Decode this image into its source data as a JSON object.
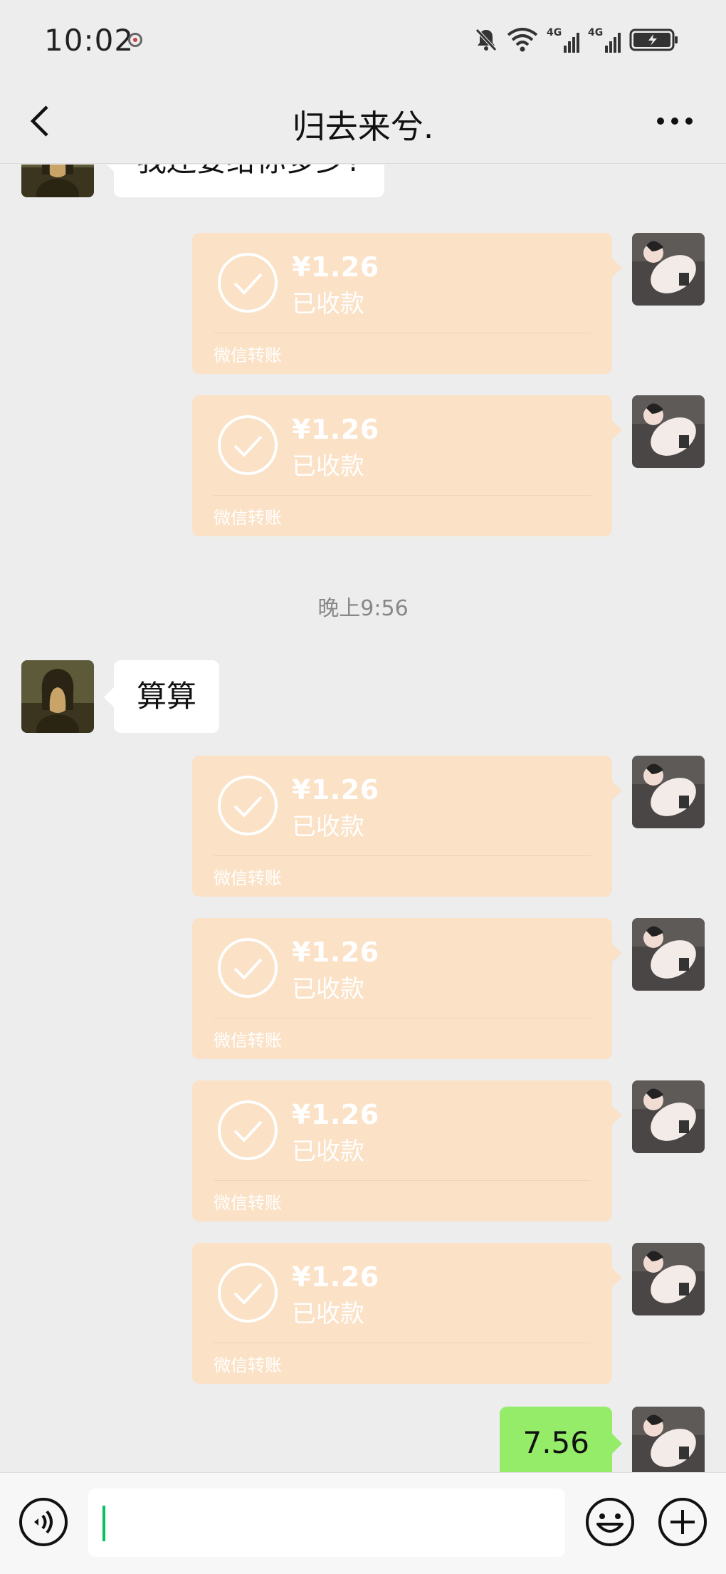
{
  "status_bar": {
    "time": "10:02",
    "network_1": "4G",
    "network_2": "4G"
  },
  "header": {
    "title": "归去来兮.",
    "back_icon": "chevron-left-icon",
    "more_icon": "more-dots-icon"
  },
  "messages": [
    {
      "type": "text",
      "side": "left",
      "text": "我还要给你多少?"
    },
    {
      "type": "transfer",
      "side": "right",
      "amount": "¥1.26",
      "status": "已收款",
      "source": "微信转账"
    },
    {
      "type": "transfer",
      "side": "right",
      "amount": "¥1.26",
      "status": "已收款",
      "source": "微信转账"
    },
    {
      "type": "time",
      "text": "晚上9:56"
    },
    {
      "type": "text",
      "side": "left",
      "text": "算算"
    },
    {
      "type": "transfer",
      "side": "right",
      "amount": "¥1.26",
      "status": "已收款",
      "source": "微信转账"
    },
    {
      "type": "transfer",
      "side": "right",
      "amount": "¥1.26",
      "status": "已收款",
      "source": "微信转账"
    },
    {
      "type": "transfer",
      "side": "right",
      "amount": "¥1.26",
      "status": "已收款",
      "source": "微信转账"
    },
    {
      "type": "transfer",
      "side": "right",
      "amount": "¥1.26",
      "status": "已收款",
      "source": "微信转账"
    },
    {
      "type": "text",
      "side": "right",
      "text": "7.56"
    }
  ],
  "input_bar": {
    "value": "",
    "voice_icon": "voice-icon",
    "emoji_icon": "emoji-icon",
    "plus_icon": "plus-icon"
  },
  "colors": {
    "background": "#ededed",
    "transfer_bubble": "#fbe1c6",
    "sent_bubble": "#95ec69",
    "received_bubble": "#ffffff",
    "caret": "#07c160"
  }
}
